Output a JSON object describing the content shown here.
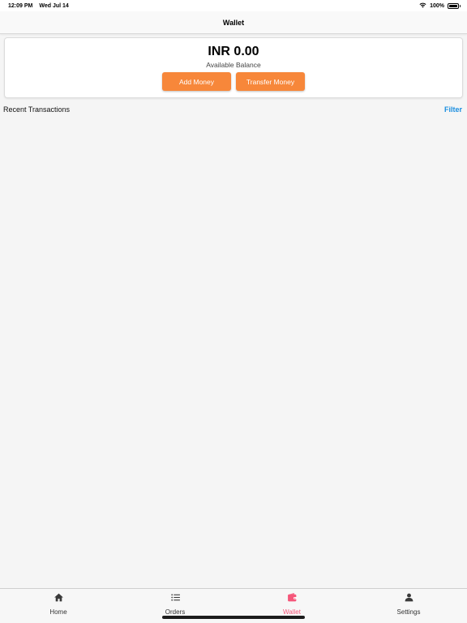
{
  "status_bar": {
    "time": "12:09 PM",
    "date": "Wed Jul 14",
    "battery": "100%",
    "icons": [
      "wifi-icon",
      "battery-icon"
    ]
  },
  "nav": {
    "title": "Wallet"
  },
  "balance": {
    "amount": "INR 0.00",
    "label": "Available Balance",
    "add_money": "Add Money",
    "transfer_money": "Transfer Money"
  },
  "transactions": {
    "title": "Recent Transactions",
    "filter": "Filter"
  },
  "tabs": [
    {
      "label": "Home",
      "icon": "home-icon",
      "active": false
    },
    {
      "label": "Orders",
      "icon": "list-icon",
      "active": false
    },
    {
      "label": "Wallet",
      "icon": "wallet-icon",
      "active": true
    },
    {
      "label": "Settings",
      "icon": "person-icon",
      "active": false
    }
  ],
  "colors": {
    "accent_orange": "#f7873a",
    "active_tab": "#f5577a",
    "link_blue": "#1a8ee0",
    "background": "#f5f5f5"
  }
}
